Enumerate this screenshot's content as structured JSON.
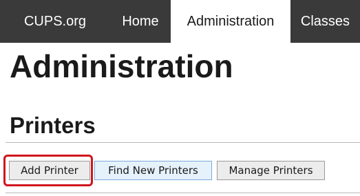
{
  "navbar": {
    "items": [
      {
        "label": "CUPS.org"
      },
      {
        "label": "Home"
      },
      {
        "label": "Administration"
      },
      {
        "label": "Classes"
      }
    ],
    "active_index": 2
  },
  "page": {
    "title": "Administration"
  },
  "printers_section": {
    "title": "Printers",
    "buttons": {
      "add": "Add Printer",
      "find": "Find New Printers",
      "manage": "Manage Printers"
    }
  },
  "annotation": {
    "highlight_color": "#d0141c"
  }
}
